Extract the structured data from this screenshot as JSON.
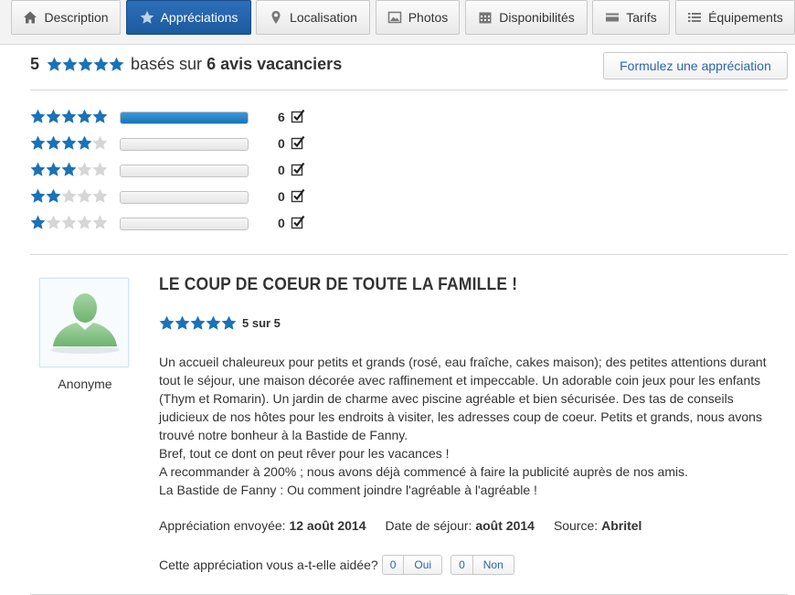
{
  "tabs": [
    {
      "label": "Description",
      "icon": "home-icon"
    },
    {
      "label": "Appréciations",
      "icon": "star-icon",
      "active": true
    },
    {
      "label": "Localisation",
      "icon": "map-pin-icon"
    },
    {
      "label": "Photos",
      "icon": "picture-icon"
    },
    {
      "label": "Disponibilités",
      "icon": "calendar-icon"
    },
    {
      "label": "Tarifs",
      "icon": "tag-icon"
    },
    {
      "label": "Équipements",
      "icon": "list-icon"
    }
  ],
  "summary": {
    "rating": "5",
    "stars": 5,
    "text_prefix": "basés sur",
    "count_text": "6 avis vacanciers"
  },
  "write_review_label": "Formulez une appréciation",
  "distribution": [
    {
      "stars": 5,
      "count": "6",
      "fraction": 1.0
    },
    {
      "stars": 4,
      "count": "0",
      "fraction": 0
    },
    {
      "stars": 3,
      "count": "0",
      "fraction": 0
    },
    {
      "stars": 2,
      "count": "0",
      "fraction": 0
    },
    {
      "stars": 1,
      "count": "0",
      "fraction": 0
    }
  ],
  "review": {
    "author": "Anonyme",
    "title": "LE COUP DE COEUR DE TOUTE LA FAMILLE !",
    "stars": 5,
    "rating_label": "5 sur 5",
    "paragraphs": [
      "Un accueil chaleureux pour petits et grands (rosé, eau fraîche, cakes maison); des petites attentions durant tout le séjour, une maison décorée avec raffinement et impeccable. Un adorable coin jeux pour les enfants (Thym et Romarin). Un jardin de charme avec piscine agréable et bien sécurisée. Des tas de conseils judicieux de nos hôtes pour les endroits à visiter, les adresses coup de coeur. Petits et grands, nous avons trouvé notre bonheur à la Bastide de Fanny.",
      "Bref, tout ce dont on peut rêver pour les vacances !",
      "A recommander à 200% ; nous avons déjà commencé à faire la publicité auprès de nos amis.",
      "La Bastide de Fanny : Ou comment joindre l'agréable à l'agréable !"
    ],
    "sent_label": "Appréciation envoyée:",
    "sent_value": "12 août 2014",
    "stay_label": "Date de séjour:",
    "stay_value": "août 2014",
    "source_label": "Source:",
    "source_value": "Abritel",
    "helpful_question": "Cette appréciation vous a-t-elle aidée?",
    "yes_count": "0",
    "yes_label": "Oui",
    "no_count": "0",
    "no_label": "Non"
  },
  "colors": {
    "star": "#1a72b8",
    "star_empty": "#d6d6d6",
    "active_tab": "#1f5fa6",
    "link": "#2a66ad"
  }
}
